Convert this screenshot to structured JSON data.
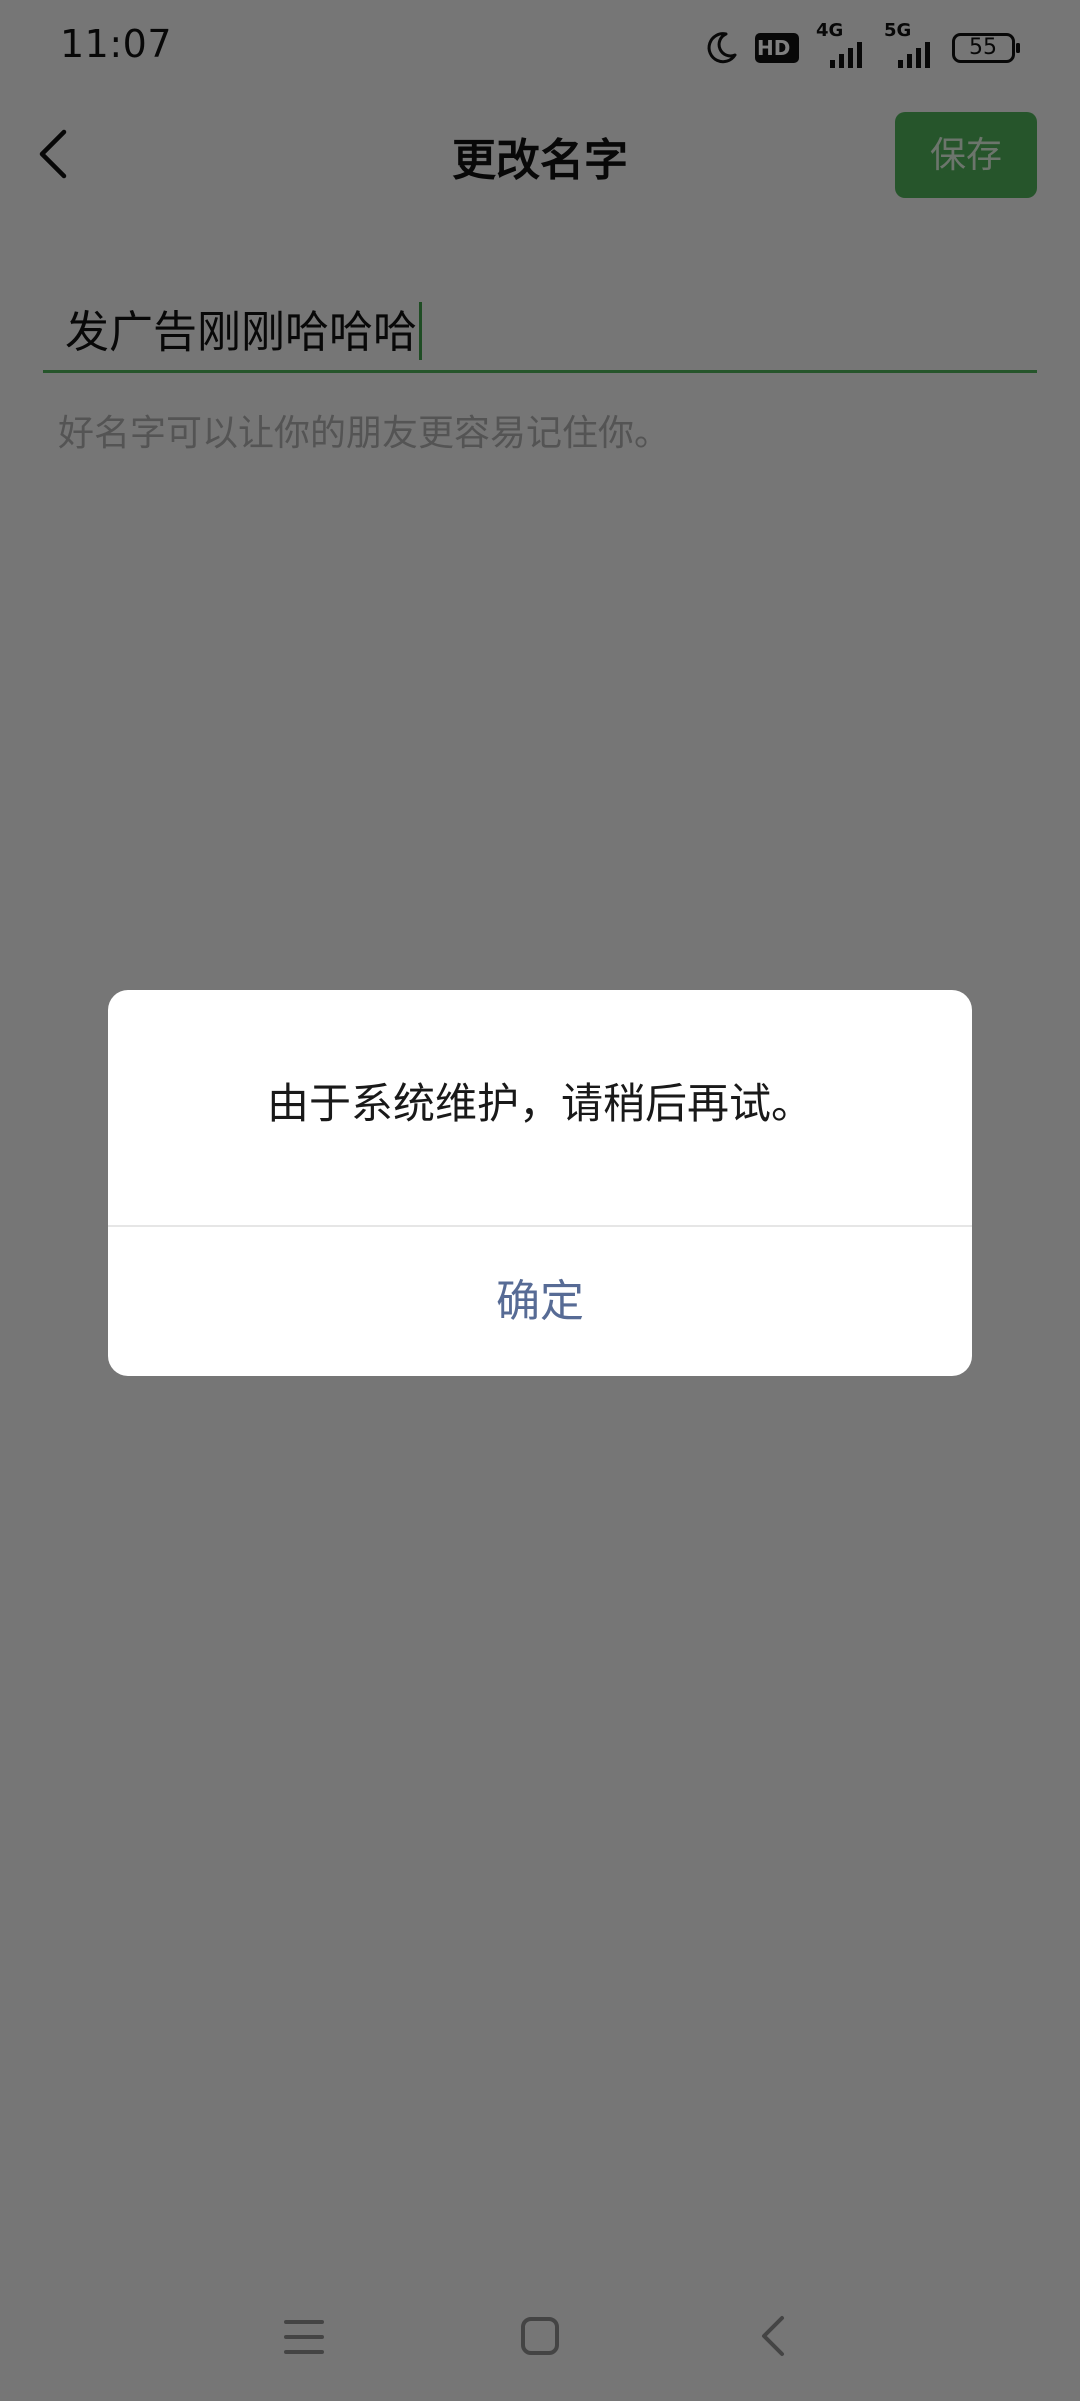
{
  "status_bar": {
    "time": "11:07",
    "hd_label": "HD",
    "network_1": "4G",
    "network_2": "5G",
    "battery": "55",
    "icons": [
      "moon-icon",
      "hd-icon",
      "signal-icon",
      "signal-icon",
      "battery-icon"
    ]
  },
  "nav": {
    "back_icon": "chevron-left-icon",
    "title": "更改名字",
    "save_label": "保存"
  },
  "form": {
    "name_value": "发广告刚刚哈哈哈",
    "hint": "好名字可以让你的朋友更容易记住你。"
  },
  "dialog": {
    "message": "由于系统维护，请稍后再试。",
    "confirm_label": "确定"
  },
  "gesture_bar": {
    "icons": [
      "menu-icon",
      "home-icon",
      "back-icon"
    ]
  },
  "colors": {
    "accent_green": "#4daa56",
    "link_blue": "#576b95",
    "overlay": "rgba(0,0,0,0.5)"
  }
}
